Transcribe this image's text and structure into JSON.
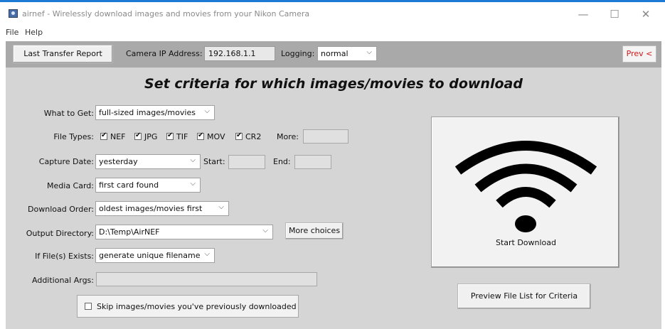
{
  "window": {
    "title": "airnef - Wirelessly download images and movies from your Nikon Camera",
    "controls": {
      "minimize": "—",
      "maximize": "☐",
      "close": "✕"
    }
  },
  "menu": {
    "items": [
      "File",
      "Help"
    ]
  },
  "toolbar": {
    "last_transfer_report": "Last Transfer Report",
    "camera_ip_label": "Camera IP Address:",
    "camera_ip_value": "192.168.1.1",
    "logging_label": "Logging:",
    "logging_value": "normal",
    "prev_label": "Prev <"
  },
  "main": {
    "heading": "Set criteria for which images/movies to download",
    "what_to_get": {
      "label": "What to Get:",
      "value": "full-sized images/movies"
    },
    "file_types": {
      "label": "File Types:",
      "types": [
        {
          "name": "NEF",
          "checked": true
        },
        {
          "name": "JPG",
          "checked": true
        },
        {
          "name": "TIF",
          "checked": true
        },
        {
          "name": "MOV",
          "checked": true
        },
        {
          "name": "CR2",
          "checked": true
        }
      ],
      "more_label": "More:",
      "more_value": ""
    },
    "capture_date": {
      "label": "Capture Date:",
      "value": "yesterday",
      "start_label": "Start:",
      "start_value": "",
      "end_label": "End:",
      "end_value": ""
    },
    "media_card": {
      "label": "Media Card:",
      "value": "first card found"
    },
    "download_order": {
      "label": "Download Order:",
      "value": "oldest images/movies first"
    },
    "output_directory": {
      "label": "Output Directory:",
      "value": "D:\\Temp\\AirNEF",
      "more_choices": "More choices"
    },
    "if_file_exists": {
      "label": "If File(s) Exists:",
      "value": "generate unique filename"
    },
    "additional_args": {
      "label": "Additional Args:",
      "value": ""
    },
    "skip_previous": {
      "label": "Skip images/movies you've previously downloaded",
      "checked": false
    },
    "start_download": {
      "label": "Start Download",
      "icon": "wifi-icon"
    },
    "preview_button": "Preview File List for Criteria"
  },
  "colors": {
    "titlebar_accent": "#1f7ad6",
    "toolbar_bg": "#a9a9a9",
    "panel_bg": "#d5d5d5",
    "prev_text": "#d01818"
  }
}
